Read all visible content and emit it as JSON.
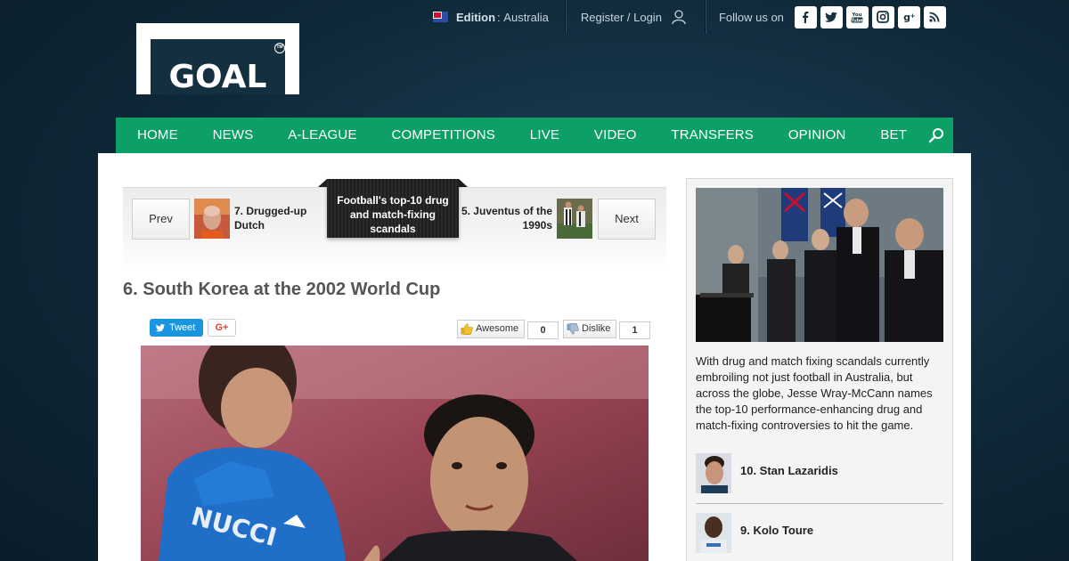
{
  "brand": {
    "logo_text": "GOAL",
    "logo_tm": "TM"
  },
  "topbar": {
    "edition_label": "Edition",
    "edition_sep": ":",
    "edition_value": "Australia",
    "login_text": "Register / Login",
    "follow_label": "Follow us on",
    "social_icons": [
      "facebook-icon",
      "twitter-icon",
      "youtube-icon",
      "instagram-icon",
      "google-plus-icon",
      "rss-icon"
    ]
  },
  "nav": {
    "items": [
      "HOME",
      "NEWS",
      "A-LEAGUE",
      "COMPETITIONS",
      "LIVE",
      "VIDEO",
      "TRANSFERS",
      "OPINION",
      "BET"
    ],
    "accent_color": "#0da066"
  },
  "slider": {
    "prev_label": "Prev",
    "next_label": "Next",
    "prev_item": "7. Drugged-up Dutch",
    "current_title": "Football's top-10 drug and match-fixing scandals",
    "next_item": "5. Juventus of the 1990s"
  },
  "article": {
    "title": "6. South Korea at the 2002 World Cup",
    "tweet_label": "Tweet",
    "gplus_label": "G+",
    "awesome_label": "Awesome",
    "awesome_count": "0",
    "dislike_label": "Dislike",
    "dislike_count": "1"
  },
  "sidebar": {
    "description": "With drug and match fixing scandals currently embroiling not just football in Australia, but across the globe, Jesse Wray-McCann names the top-10 performance-enhancing drug and match-fixing controversies to hit the game.",
    "items": [
      {
        "label": "10. Stan Lazaridis"
      },
      {
        "label": "9. Kolo Toure"
      }
    ]
  }
}
